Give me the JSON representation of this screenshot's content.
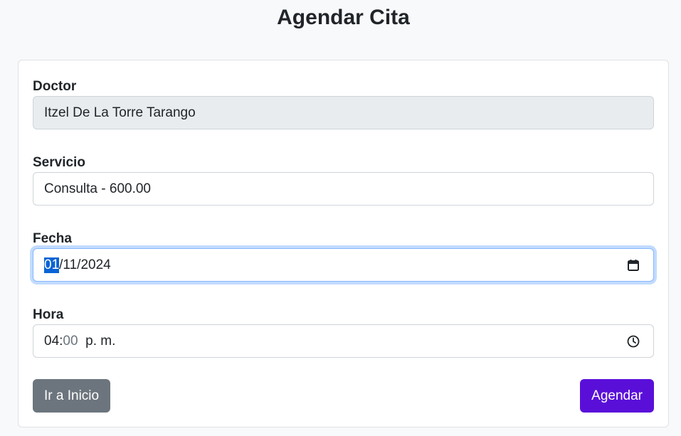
{
  "page": {
    "title": "Agendar Cita"
  },
  "form": {
    "doctor": {
      "label": "Doctor",
      "value": "Itzel De La Torre Tarango"
    },
    "servicio": {
      "label": "Servicio",
      "value": "Consulta - 600.00"
    },
    "fecha": {
      "label": "Fecha",
      "day": "01",
      "sep1": "/",
      "month": "11",
      "sep2": "/",
      "year": "2024",
      "icon": "calendar-icon"
    },
    "hora": {
      "label": "Hora",
      "hour": "04",
      "sep": ":",
      "minute": "00",
      "ampm": "p. m.",
      "icon": "clock-icon"
    }
  },
  "buttons": {
    "home_label": "Ir a Inicio",
    "submit_label": "Agendar"
  },
  "colors": {
    "primary": "#5a0fd9",
    "secondary": "#6c757d",
    "focus_ring": "#86b7fe",
    "selection": "#0a63d4"
  }
}
